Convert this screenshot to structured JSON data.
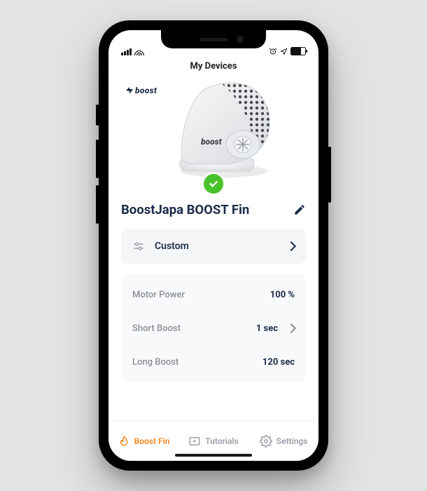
{
  "status": {},
  "header": {
    "title": "My Devices"
  },
  "brand": "boost",
  "device": {
    "name": "BoostJapa BOOST Fin"
  },
  "mode": {
    "label": "Custom"
  },
  "settings": {
    "motor_power": {
      "label": "Motor Power",
      "value": "100 %"
    },
    "short_boost": {
      "label": "Short Boost",
      "value": "1 sec"
    },
    "long_boost": {
      "label": "Long Boost",
      "value": "120 sec"
    }
  },
  "tabs": {
    "boost_fin": "Boost Fin",
    "tutorials": "Tutorials",
    "settings": "Settings"
  }
}
